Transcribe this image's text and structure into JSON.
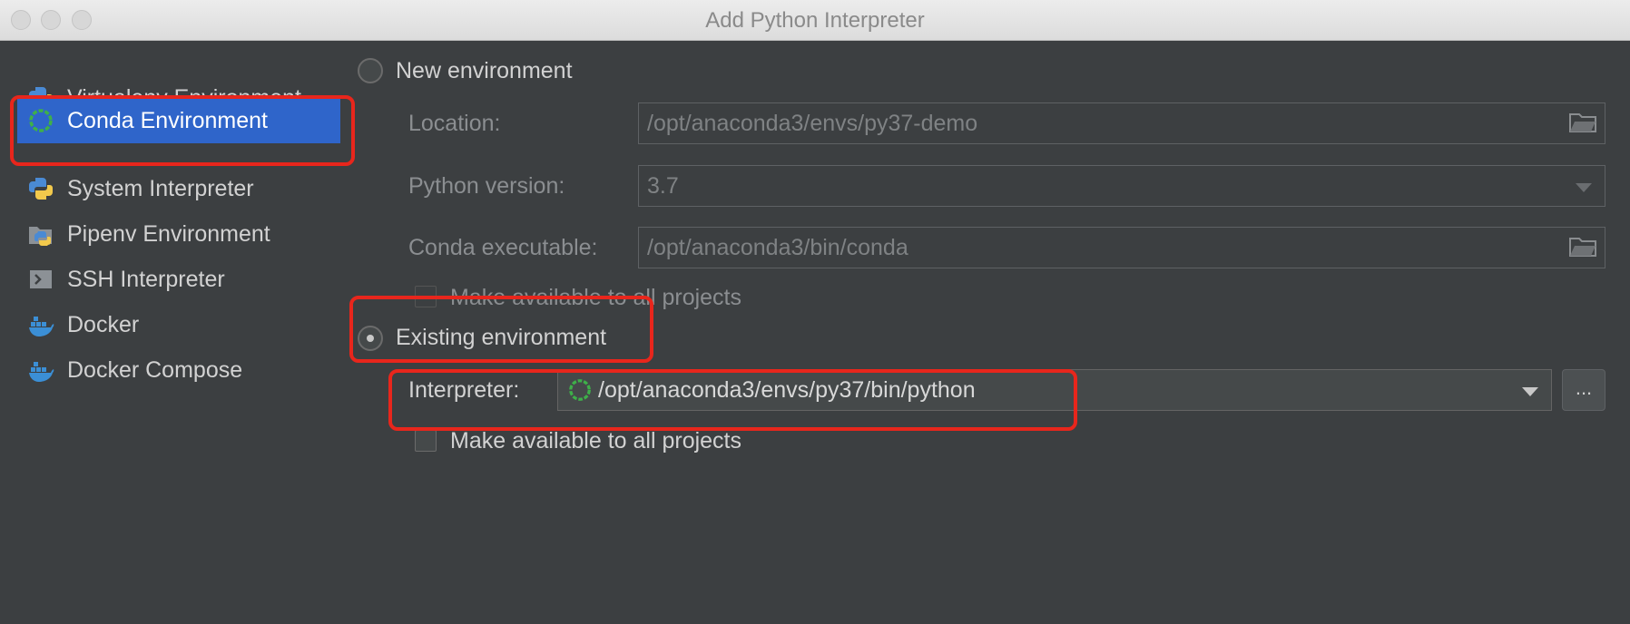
{
  "window": {
    "title": "Add Python Interpreter"
  },
  "sidebar": {
    "items": [
      {
        "label": "Virtualenv Environment",
        "icon": "python-virtualenv-icon",
        "selected": false
      },
      {
        "label": "Conda Environment",
        "icon": "conda-icon",
        "selected": true
      },
      {
        "label": "System Interpreter",
        "icon": "python-icon",
        "selected": false
      },
      {
        "label": "Pipenv Environment",
        "icon": "pipenv-icon",
        "selected": false
      },
      {
        "label": "SSH Interpreter",
        "icon": "ssh-terminal-icon",
        "selected": false
      },
      {
        "label": "Docker",
        "icon": "docker-icon",
        "selected": false
      },
      {
        "label": "Docker Compose",
        "icon": "docker-compose-icon",
        "selected": false
      }
    ]
  },
  "new_env": {
    "radio_label": "New environment",
    "selected": false,
    "location_label": "Location:",
    "location_value": "/opt/anaconda3/envs/py37-demo",
    "python_version_label": "Python version:",
    "python_version_value": "3.7",
    "conda_exec_label": "Conda executable:",
    "conda_exec_value": "/opt/anaconda3/bin/conda",
    "make_available_label": "Make available to all projects",
    "make_available_checked": false
  },
  "existing_env": {
    "radio_label": "Existing environment",
    "selected": true,
    "interpreter_label": "Interpreter:",
    "interpreter_value": "/opt/anaconda3/envs/py37/bin/python",
    "browse_label": "...",
    "make_available_label": "Make available to all projects",
    "make_available_checked": false
  },
  "colors": {
    "background": "#3c3f41",
    "selection": "#2f65ca",
    "annotation_red": "#e8261c",
    "conda_green": "#3eb049"
  }
}
